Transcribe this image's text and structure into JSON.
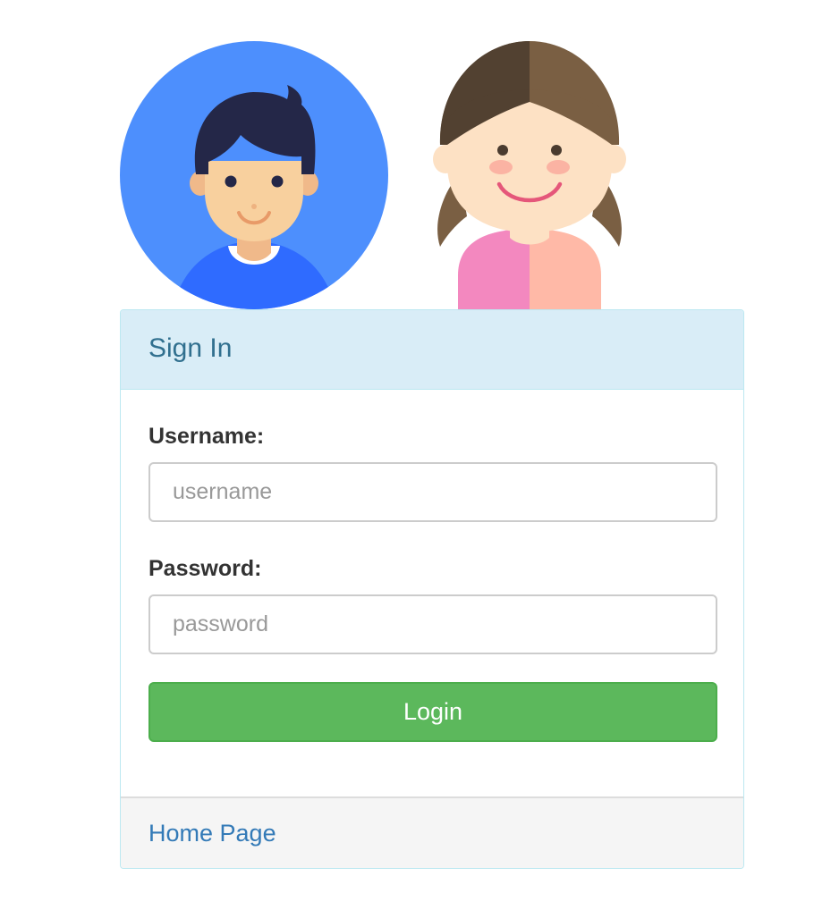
{
  "avatars": {
    "boy": "boy-avatar",
    "girl": "girl-avatar"
  },
  "panel": {
    "title": "Sign In",
    "username_label": "Username:",
    "username_placeholder": "username",
    "username_value": "",
    "password_label": "Password:",
    "password_placeholder": "password",
    "password_value": "",
    "login_label": "Login",
    "footer_link": "Home Page"
  },
  "colors": {
    "panel_heading_bg": "#d9edf7",
    "panel_border": "#bce8f1",
    "title_color": "#31708f",
    "button_green": "#5cb85c",
    "link_blue": "#337ab7",
    "boy_circle": "#4d8ffd"
  }
}
